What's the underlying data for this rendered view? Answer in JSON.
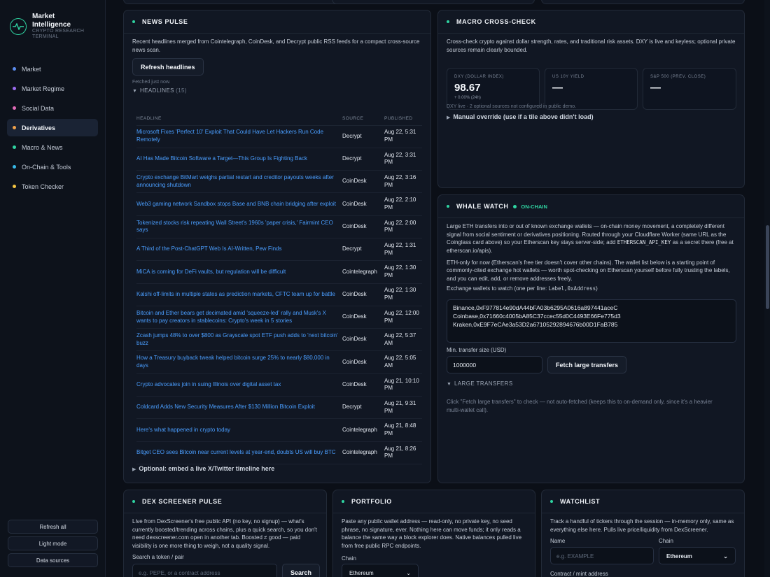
{
  "brand": {
    "title": "Market Intelligence",
    "subtitle": "CRYPTO RESEARCH TERMINAL"
  },
  "nav": [
    {
      "label": "Market",
      "color": "#5b8def"
    },
    {
      "label": "Market Regime",
      "color": "#9b6cf0"
    },
    {
      "label": "Social Data",
      "color": "#e26bb8"
    },
    {
      "label": "Derivatives",
      "color": "#f0a14a"
    },
    {
      "label": "Macro & News",
      "color": "#2fd3a1"
    },
    {
      "label": "On-Chain & Tools",
      "color": "#37b8e6"
    },
    {
      "label": "Token Checker",
      "color": "#f5c542"
    }
  ],
  "active_nav": "Derivatives",
  "sidebar_buttons": {
    "refresh": "Refresh all",
    "light": "Light mode",
    "sources": "Data sources"
  },
  "news": {
    "title": "NEWS PULSE",
    "desc": "Recent headlines merged from Cointelegraph, CoinDesk, and Decrypt public RSS feeds for a compact cross-source news scan.",
    "refresh_label": "Refresh headlines",
    "fetched": "Fetched just now.",
    "headlines_label": "HEADLINES",
    "headlines_count": "(15)",
    "columns": {
      "headline": "HEADLINE",
      "source": "SOURCE",
      "published": "PUBLISHED"
    },
    "rows": [
      {
        "h": "Microsoft Fixes 'Perfect 10' Exploit That Could Have Let Hackers Run Code Remotely",
        "s": "Decrypt",
        "p": "Aug 22, 5:31 PM"
      },
      {
        "h": "AI Has Made Bitcoin Software a Target—This Group Is Fighting Back",
        "s": "Decrypt",
        "p": "Aug 22, 3:31 PM"
      },
      {
        "h": "Crypto exchange BitMart weighs partial restart and creditor payouts weeks after announcing shutdown",
        "s": "CoinDesk",
        "p": "Aug 22, 3:16 PM"
      },
      {
        "h": "Web3 gaming network Sandbox stops Base and BNB chain bridging after exploit",
        "s": "CoinDesk",
        "p": "Aug 22, 2:10 PM"
      },
      {
        "h": "Tokenized stocks risk repeating Wall Street's 1960s 'paper crisis,' Fairmint CEO says",
        "s": "CoinDesk",
        "p": "Aug 22, 2:00 PM"
      },
      {
        "h": "A Third of the Post-ChatGPT Web Is AI-Written, Pew Finds",
        "s": "Decrypt",
        "p": "Aug 22, 1:31 PM"
      },
      {
        "h": "MiCA is coming for DeFi vaults, but regulation will be difficult",
        "s": "Cointelegraph",
        "p": "Aug 22, 1:30 PM"
      },
      {
        "h": "Kalshi off-limits in multiple states as prediction markets, CFTC team up for battle",
        "s": "CoinDesk",
        "p": "Aug 22, 1:30 PM"
      },
      {
        "h": "Bitcoin and Ether bears get decimated amid 'squeeze-led' rally and Musk's X wants to pay creators in stablecoins: Crypto's week in 5 stories",
        "s": "CoinDesk",
        "p": "Aug 22, 12:00 PM"
      },
      {
        "h": "Zcash jumps 48% to over $800 as Grayscale spot ETF push adds to 'next bitcoin' buzz",
        "s": "CoinDesk",
        "p": "Aug 22, 5:37 AM"
      },
      {
        "h": "How a Treasury buyback tweak helped bitcoin surge 25% to nearly $80,000 in days",
        "s": "CoinDesk",
        "p": "Aug 22, 5:05 AM"
      },
      {
        "h": "Crypto advocates join in suing Illinois over digital asset tax",
        "s": "CoinDesk",
        "p": "Aug 21, 10:10 PM"
      },
      {
        "h": "Coldcard Adds New Security Measures After $130 Million Bitcoin Exploit",
        "s": "Decrypt",
        "p": "Aug 21, 9:31 PM"
      },
      {
        "h": "Here's what happened in crypto today",
        "s": "Cointelegraph",
        "p": "Aug 21, 8:48 PM"
      },
      {
        "h": "Bitget CEO sees Bitcoin near current levels at year-end, doubts US will buy BTC",
        "s": "Cointelegraph",
        "p": "Aug 21, 8:26 PM"
      }
    ],
    "embed_label": "Optional: embed a live X/Twitter timeline here"
  },
  "macro": {
    "title": "MACRO CROSS-CHECK",
    "desc": "Cross-check crypto against dollar strength, rates, and traditional risk assets. DXY is live and keyless; optional private sources remain clearly bounded.",
    "tiles": [
      {
        "label": "DXY (DOLLAR INDEX)",
        "value": "98.67",
        "sub": "+ 0.00% (24h)"
      },
      {
        "label": "US 10Y YIELD",
        "value": "—",
        "sub": ""
      },
      {
        "label": "S&P 500 (PREV. CLOSE)",
        "value": "—",
        "sub": ""
      }
    ],
    "note": "DXY live · 2 optional sources not configured in public demo.",
    "override": "Manual override (use if a tile above didn't load)"
  },
  "whale": {
    "title": "WHALE WATCH",
    "badge": "ON-CHAIN",
    "desc1_a": "Large ETH transfers into or out of known exchange wallets — on-chain money movement, a completely different signal from social sentiment or derivatives positioning. Routed through your Cloudflare Worker (same URL as the Coinglass card above) so your Etherscan key stays server-side; add",
    "desc1_code": "ETHERSCAN_API_KEY",
    "desc1_b": "as a secret there (free at etherscan.io/apis).",
    "desc2": "ETH-only for now (Etherscan's free tier doesn't cover other chains). The wallet list below is a starting point of commonly-cited exchange hot wallets — worth spot-checking on Etherscan yourself before fully trusting the labels, and you can edit, add, or remove addresses freely.",
    "wallets_label": "Exchange wallets to watch (one per line:",
    "wallets_code": "Label,0xAddress",
    "wallets_close": ")",
    "wallets": "Binance,0xF977814e90dA44bFA03b6295A0616a897441aceC\nCoinbase,0x71660c4005bA85C37ccec55d0C4493E66Fe775d3\nKraken,0xE9F7eCAe3a53D2a67105292894676b00D1FaB785",
    "min_label": "Min. transfer size (USD)",
    "min_value": "1000000",
    "fetch_label": "Fetch large transfers",
    "large_label": "LARGE TRANSFERS",
    "large_note": "Click \"Fetch large transfers\" to check — not auto-fetched (keeps this to on-demand only, since it's a heavier multi-wallet call)."
  },
  "dex": {
    "title": "DEX SCREENER PULSE",
    "desc": "Live from DexScreener's free public API (no key, no signup) — what's currently boosted/trending across chains, plus a quick search, so you don't need dexscreener.com open in another tab. Boosted ≠ good — paid visibility is one more thing to weigh, not a quality signal.",
    "search_label": "Search a token / pair",
    "search_placeholder": "e.g. PEPE, or a contract address",
    "search_button": "Search"
  },
  "portfolio": {
    "title": "PORTFOLIO",
    "desc": "Paste any public wallet address — read-only, no private key, no seed phrase, no signature, ever. Nothing here can move funds; it only reads a balance the same way a block explorer does. Native balances pulled live from free public RPC endpoints.",
    "chain_label": "Chain",
    "chain_value": "Ethereum"
  },
  "watchlist": {
    "title": "WATCHLIST",
    "desc": "Track a handful of tickers through the session — in-memory only, same as everything else here. Pulls live price/liquidity from DexScreener.",
    "name_label": "Name",
    "name_placeholder": "e.g. EXAMPLE",
    "chain_label": "Chain",
    "chain_value": "Ethereum",
    "contract_label": "Contract / mint address"
  }
}
